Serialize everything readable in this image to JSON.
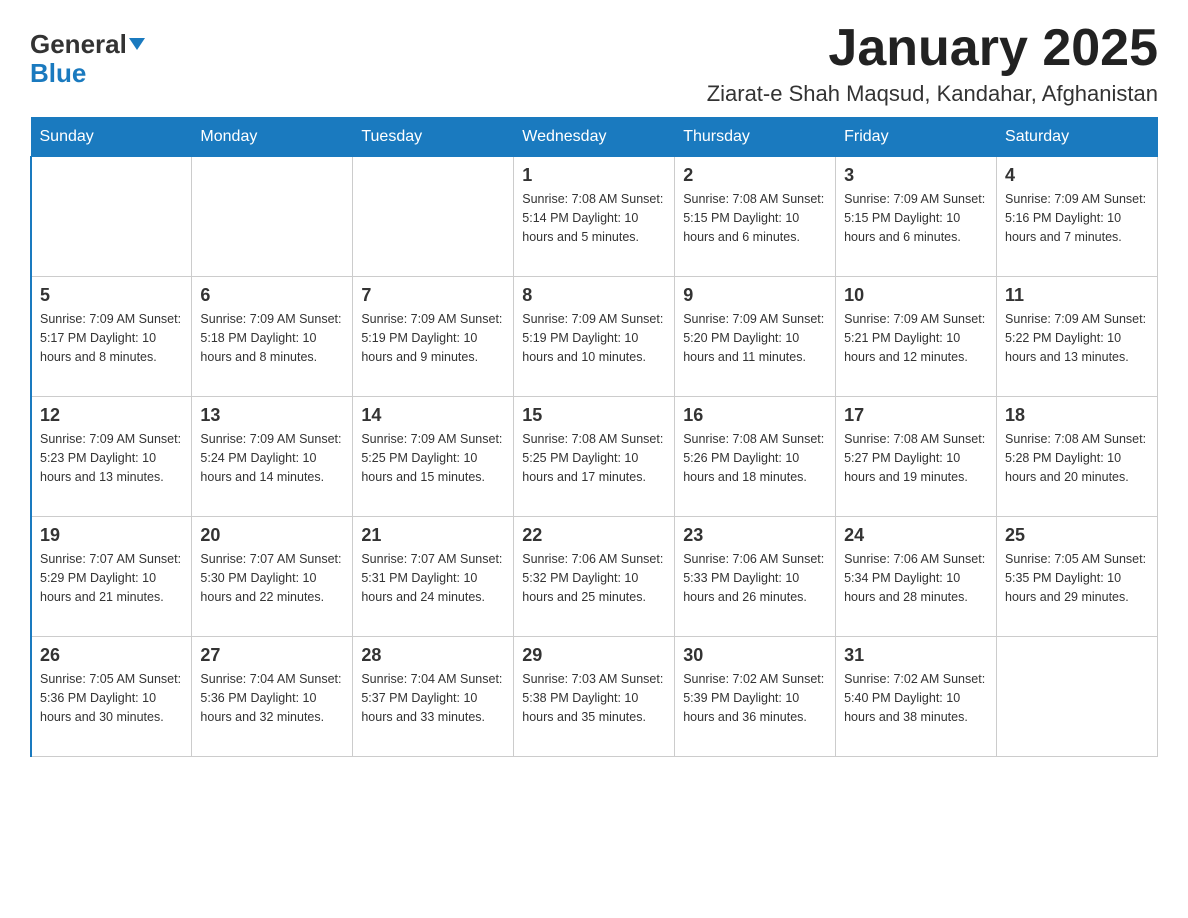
{
  "header": {
    "logo_general": "General",
    "logo_blue": "Blue",
    "title": "January 2025",
    "subtitle": "Ziarat-e Shah Maqsud, Kandahar, Afghanistan"
  },
  "days_of_week": [
    "Sunday",
    "Monday",
    "Tuesday",
    "Wednesday",
    "Thursday",
    "Friday",
    "Saturday"
  ],
  "weeks": [
    [
      {
        "day": "",
        "info": ""
      },
      {
        "day": "",
        "info": ""
      },
      {
        "day": "",
        "info": ""
      },
      {
        "day": "1",
        "info": "Sunrise: 7:08 AM\nSunset: 5:14 PM\nDaylight: 10 hours and 5 minutes."
      },
      {
        "day": "2",
        "info": "Sunrise: 7:08 AM\nSunset: 5:15 PM\nDaylight: 10 hours and 6 minutes."
      },
      {
        "day": "3",
        "info": "Sunrise: 7:09 AM\nSunset: 5:15 PM\nDaylight: 10 hours and 6 minutes."
      },
      {
        "day": "4",
        "info": "Sunrise: 7:09 AM\nSunset: 5:16 PM\nDaylight: 10 hours and 7 minutes."
      }
    ],
    [
      {
        "day": "5",
        "info": "Sunrise: 7:09 AM\nSunset: 5:17 PM\nDaylight: 10 hours and 8 minutes."
      },
      {
        "day": "6",
        "info": "Sunrise: 7:09 AM\nSunset: 5:18 PM\nDaylight: 10 hours and 8 minutes."
      },
      {
        "day": "7",
        "info": "Sunrise: 7:09 AM\nSunset: 5:19 PM\nDaylight: 10 hours and 9 minutes."
      },
      {
        "day": "8",
        "info": "Sunrise: 7:09 AM\nSunset: 5:19 PM\nDaylight: 10 hours and 10 minutes."
      },
      {
        "day": "9",
        "info": "Sunrise: 7:09 AM\nSunset: 5:20 PM\nDaylight: 10 hours and 11 minutes."
      },
      {
        "day": "10",
        "info": "Sunrise: 7:09 AM\nSunset: 5:21 PM\nDaylight: 10 hours and 12 minutes."
      },
      {
        "day": "11",
        "info": "Sunrise: 7:09 AM\nSunset: 5:22 PM\nDaylight: 10 hours and 13 minutes."
      }
    ],
    [
      {
        "day": "12",
        "info": "Sunrise: 7:09 AM\nSunset: 5:23 PM\nDaylight: 10 hours and 13 minutes."
      },
      {
        "day": "13",
        "info": "Sunrise: 7:09 AM\nSunset: 5:24 PM\nDaylight: 10 hours and 14 minutes."
      },
      {
        "day": "14",
        "info": "Sunrise: 7:09 AM\nSunset: 5:25 PM\nDaylight: 10 hours and 15 minutes."
      },
      {
        "day": "15",
        "info": "Sunrise: 7:08 AM\nSunset: 5:25 PM\nDaylight: 10 hours and 17 minutes."
      },
      {
        "day": "16",
        "info": "Sunrise: 7:08 AM\nSunset: 5:26 PM\nDaylight: 10 hours and 18 minutes."
      },
      {
        "day": "17",
        "info": "Sunrise: 7:08 AM\nSunset: 5:27 PM\nDaylight: 10 hours and 19 minutes."
      },
      {
        "day": "18",
        "info": "Sunrise: 7:08 AM\nSunset: 5:28 PM\nDaylight: 10 hours and 20 minutes."
      }
    ],
    [
      {
        "day": "19",
        "info": "Sunrise: 7:07 AM\nSunset: 5:29 PM\nDaylight: 10 hours and 21 minutes."
      },
      {
        "day": "20",
        "info": "Sunrise: 7:07 AM\nSunset: 5:30 PM\nDaylight: 10 hours and 22 minutes."
      },
      {
        "day": "21",
        "info": "Sunrise: 7:07 AM\nSunset: 5:31 PM\nDaylight: 10 hours and 24 minutes."
      },
      {
        "day": "22",
        "info": "Sunrise: 7:06 AM\nSunset: 5:32 PM\nDaylight: 10 hours and 25 minutes."
      },
      {
        "day": "23",
        "info": "Sunrise: 7:06 AM\nSunset: 5:33 PM\nDaylight: 10 hours and 26 minutes."
      },
      {
        "day": "24",
        "info": "Sunrise: 7:06 AM\nSunset: 5:34 PM\nDaylight: 10 hours and 28 minutes."
      },
      {
        "day": "25",
        "info": "Sunrise: 7:05 AM\nSunset: 5:35 PM\nDaylight: 10 hours and 29 minutes."
      }
    ],
    [
      {
        "day": "26",
        "info": "Sunrise: 7:05 AM\nSunset: 5:36 PM\nDaylight: 10 hours and 30 minutes."
      },
      {
        "day": "27",
        "info": "Sunrise: 7:04 AM\nSunset: 5:36 PM\nDaylight: 10 hours and 32 minutes."
      },
      {
        "day": "28",
        "info": "Sunrise: 7:04 AM\nSunset: 5:37 PM\nDaylight: 10 hours and 33 minutes."
      },
      {
        "day": "29",
        "info": "Sunrise: 7:03 AM\nSunset: 5:38 PM\nDaylight: 10 hours and 35 minutes."
      },
      {
        "day": "30",
        "info": "Sunrise: 7:02 AM\nSunset: 5:39 PM\nDaylight: 10 hours and 36 minutes."
      },
      {
        "day": "31",
        "info": "Sunrise: 7:02 AM\nSunset: 5:40 PM\nDaylight: 10 hours and 38 minutes."
      },
      {
        "day": "",
        "info": ""
      }
    ]
  ]
}
